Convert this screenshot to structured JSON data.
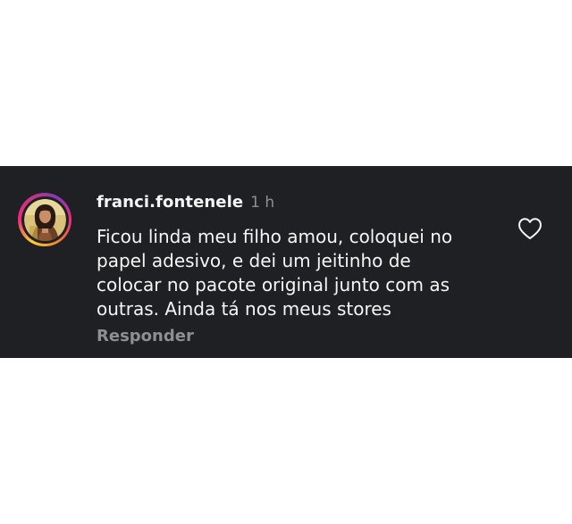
{
  "comment": {
    "username": "franci.fontenele",
    "timestamp": "1 h",
    "text": "Ficou linda meu filho amou, coloquei no\npapel adesivo, e dei um jeitinho de\ncolocar no pacote original junto com as\noutras. Ainda tá nos meus stores",
    "reply_label": "Responder",
    "has_story_ring": true,
    "like_icon": "heart-outline-icon"
  },
  "colors": {
    "card_background": "#1f2024",
    "primary_text": "#f5f5f5",
    "secondary_text": "#8e8e93",
    "page_background": "#ffffff"
  }
}
